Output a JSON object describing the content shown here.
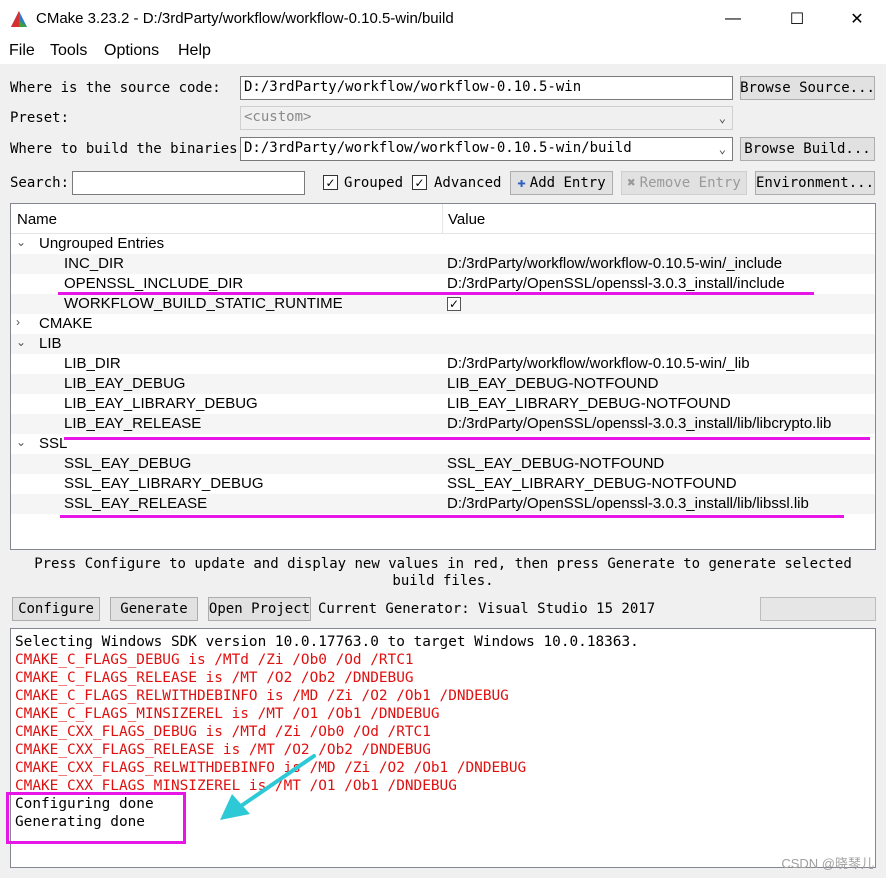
{
  "window": {
    "title": "CMake 3.23.2 - D:/3rdParty/workflow/workflow-0.10.5-win/build",
    "minimize": "—",
    "maximize": "☐",
    "close": "✕"
  },
  "menu": [
    "File",
    "Tools",
    "Options",
    "Help"
  ],
  "form": {
    "source_label": "Where is the source code:",
    "source_value": "D:/3rdParty/workflow/workflow-0.10.5-win",
    "browse_source": "Browse Source...",
    "preset_label": "Preset:",
    "preset_value": "<custom>",
    "binaries_label": "Where to build the binaries:",
    "binaries_value": "D:/3rdParty/workflow/workflow-0.10.5-win/build",
    "browse_build": "Browse Build...",
    "search_label": "Search:",
    "search_value": "",
    "grouped_label": "Grouped",
    "grouped_checked": true,
    "advanced_label": "Advanced",
    "advanced_checked": true,
    "add_entry": "Add Entry",
    "remove_entry": "Remove Entry",
    "environment": "Environment..."
  },
  "tree": {
    "header_name": "Name",
    "header_value": "Value",
    "groups": {
      "ungrouped": "Ungrouped Entries",
      "cmake": "CMAKE",
      "lib": "LIB",
      "ssl": "SSL"
    },
    "entries": {
      "inc_dir": {
        "name": "INC_DIR",
        "value": "D:/3rdParty/workflow/workflow-0.10.5-win/_include"
      },
      "openssl_include_dir": {
        "name": "OPENSSL_INCLUDE_DIR",
        "value": "D:/3rdParty/OpenSSL/openssl-3.0.3_install/include"
      },
      "workflow_build_static_runtime": {
        "name": "WORKFLOW_BUILD_STATIC_RUNTIME",
        "checked": true
      },
      "lib_dir": {
        "name": "LIB_DIR",
        "value": "D:/3rdParty/workflow/workflow-0.10.5-win/_lib"
      },
      "lib_eay_debug": {
        "name": "LIB_EAY_DEBUG",
        "value": "LIB_EAY_DEBUG-NOTFOUND"
      },
      "lib_eay_library_debug": {
        "name": "LIB_EAY_LIBRARY_DEBUG",
        "value": "LIB_EAY_LIBRARY_DEBUG-NOTFOUND"
      },
      "lib_eay_release": {
        "name": "LIB_EAY_RELEASE",
        "value": "D:/3rdParty/OpenSSL/openssl-3.0.3_install/lib/libcrypto.lib"
      },
      "ssl_eay_debug": {
        "name": "SSL_EAY_DEBUG",
        "value": "SSL_EAY_DEBUG-NOTFOUND"
      },
      "ssl_eay_library_debug": {
        "name": "SSL_EAY_LIBRARY_DEBUG",
        "value": "SSL_EAY_LIBRARY_DEBUG-NOTFOUND"
      },
      "ssl_eay_release": {
        "name": "SSL_EAY_RELEASE",
        "value": "D:/3rdParty/OpenSSL/openssl-3.0.3_install/lib/libssl.lib"
      }
    }
  },
  "message": "Press Configure to update and display new values in red, then press Generate to generate selected build files.",
  "actions": {
    "configure": "Configure",
    "generate": "Generate",
    "open_project": "Open Project",
    "generator": "Current Generator: Visual Studio 15 2017"
  },
  "output": {
    "line1": "Selecting Windows SDK version 10.0.17763.0 to target Windows 10.0.18363.",
    "line2": "CMAKE_C_FLAGS_DEBUG is /MTd /Zi /Ob0 /Od /RTC1",
    "line3": "CMAKE_C_FLAGS_RELEASE is /MT /O2 /Ob2 /DNDEBUG",
    "line4": "CMAKE_C_FLAGS_RELWITHDEBINFO is /MD /Zi /O2 /Ob1 /DNDEBUG",
    "line5": "CMAKE_C_FLAGS_MINSIZEREL is /MT /O1 /Ob1 /DNDEBUG",
    "line6": "CMAKE_CXX_FLAGS_DEBUG is /MTd /Zi /Ob0 /Od /RTC1",
    "line7": "CMAKE_CXX_FLAGS_RELEASE is /MT /O2 /Ob2 /DNDEBUG",
    "line8": "CMAKE_CXX_FLAGS_RELWITHDEBINFO is /MD /Zi /O2 /Ob1 /DNDEBUG",
    "line9": "CMAKE_CXX_FLAGS_MINSIZEREL is /MT /O1 /Ob1 /DNDEBUG",
    "line10": "Configuring done",
    "line11": "Generating done"
  },
  "watermark": "CSDN @晓琴儿",
  "colors": {
    "highlight": "#e617e6",
    "arrow": "#2ec9d6",
    "warning_text": "#e01010"
  }
}
